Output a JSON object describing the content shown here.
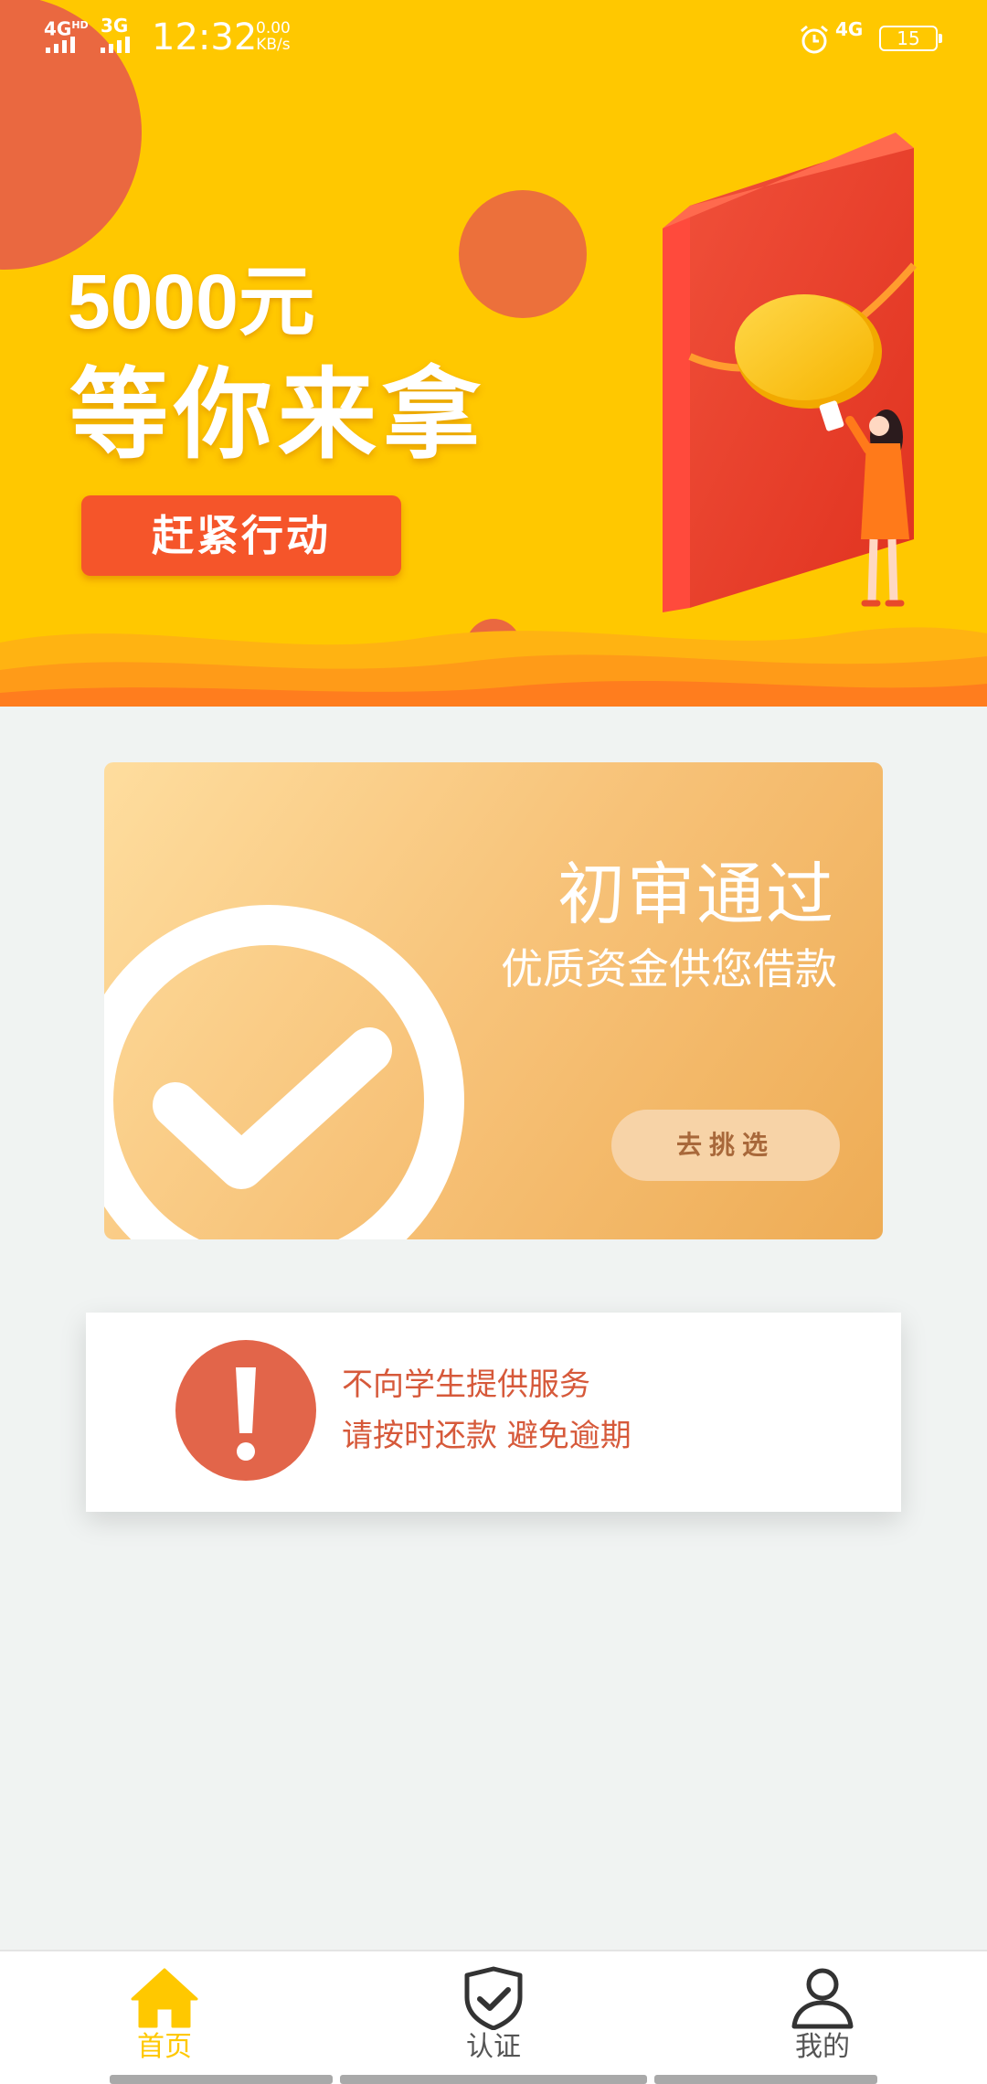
{
  "status_bar": {
    "network_left_1": "4G",
    "network_left_1_sup": "HD",
    "network_left_2": "3G",
    "time": "12:32",
    "speed_value": "0.00",
    "speed_unit": "KB/s",
    "network_right": "4G",
    "battery": "15"
  },
  "banner": {
    "amount": "5000元",
    "slogan": "等你来拿",
    "cta_label": "赶紧行动",
    "colors": {
      "background": "#ffc800",
      "accent": "#ea6840",
      "cta": "#f5552a"
    }
  },
  "approval_card": {
    "title": "初审通过",
    "subtitle": "优质资金供您借款",
    "button_label": "去挑选",
    "icon": "check-circle-icon"
  },
  "notice": {
    "icon": "exclamation-icon",
    "line1": "不向学生提供服务",
    "line2": "请按时还款 避免逾期",
    "color": "#d6593a"
  },
  "bottom_nav": {
    "items": [
      {
        "label": "首页",
        "icon": "home-icon",
        "active": true
      },
      {
        "label": "认证",
        "icon": "shield-check-icon",
        "active": false
      },
      {
        "label": "我的",
        "icon": "user-icon",
        "active": false
      }
    ],
    "active_color": "#ffc800"
  }
}
